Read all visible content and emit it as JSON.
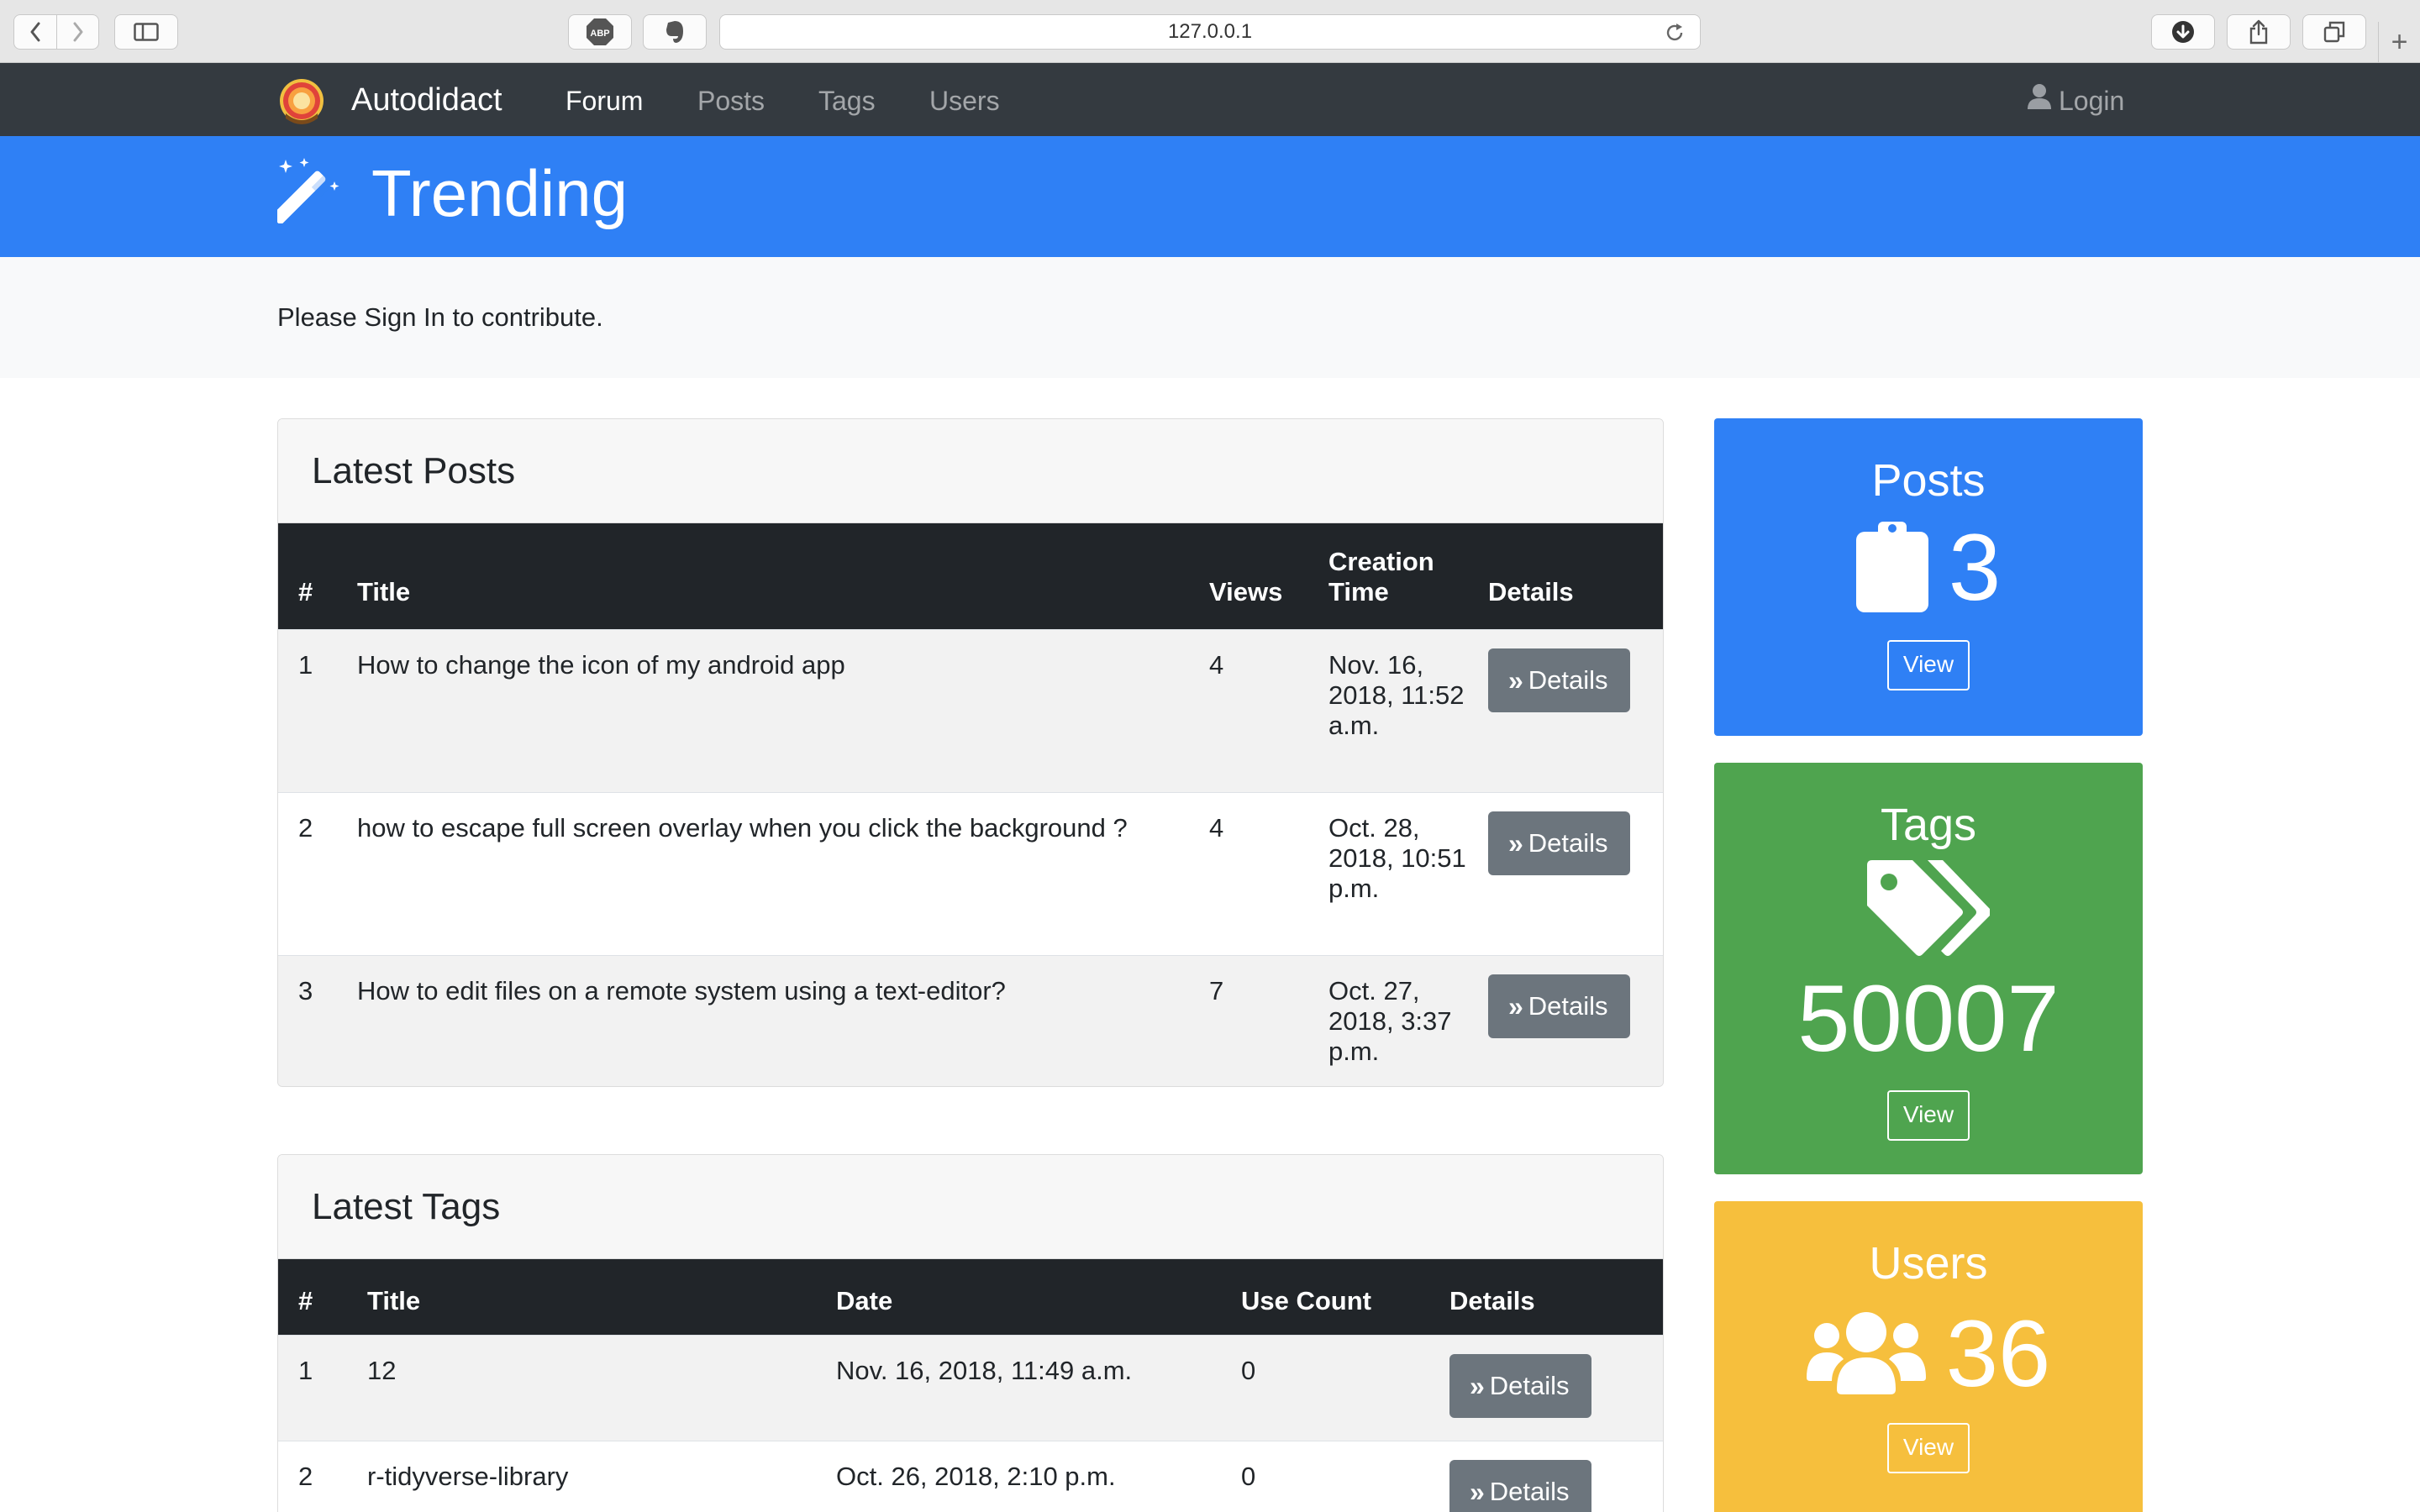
{
  "browser": {
    "url": "127.0.0.1",
    "icons": [
      "back-icon",
      "forward-icon",
      "sidebar-icon",
      "adblock-icon",
      "evernote-icon",
      "reload-icon",
      "download-icon",
      "share-icon",
      "tabs-icon",
      "new-tab-icon"
    ],
    "new_tab": "+"
  },
  "navbar": {
    "brand": "Autodidact",
    "links": [
      {
        "label": "Forum",
        "active": true
      },
      {
        "label": "Posts",
        "active": false
      },
      {
        "label": "Tags",
        "active": false
      },
      {
        "label": "Users",
        "active": false
      }
    ],
    "login": "Login"
  },
  "banner": {
    "title": "Trending",
    "color": "#2f80f5"
  },
  "notice": "Please Sign In to contribute.",
  "latest_posts": {
    "title": "Latest Posts",
    "columns": [
      "#",
      "Title",
      "Views",
      "Creation Time",
      "Details"
    ],
    "rows": [
      {
        "num": "1",
        "title": "How to change the icon of my android app",
        "views": "4",
        "time": "Nov. 16, 2018, 11:52 a.m.",
        "button": "Details"
      },
      {
        "num": "2",
        "title": "how to escape full screen overlay when you click the background ?",
        "views": "4",
        "time": "Oct. 28, 2018, 10:51 p.m.",
        "button": "Details"
      },
      {
        "num": "3",
        "title": "How to edit files on a remote system using a text-editor?",
        "views": "7",
        "time": "Oct. 27, 2018, 3:37 p.m.",
        "button": "Details"
      }
    ]
  },
  "latest_tags": {
    "title": "Latest Tags",
    "columns": [
      "#",
      "Title",
      "Date",
      "Use Count",
      "Details"
    ],
    "rows": [
      {
        "num": "1",
        "title": "12",
        "date": "Nov. 16, 2018, 11:49 a.m.",
        "count": "0",
        "button": "Details"
      },
      {
        "num": "2",
        "title": "r-tidyverse-library",
        "date": "Oct. 26, 2018, 2:10 p.m.",
        "count": "0",
        "button": "Details"
      }
    ]
  },
  "stats": [
    {
      "title": "Posts",
      "count": "3",
      "view": "View",
      "color": "#2f80f5",
      "icon": "clipboard-icon"
    },
    {
      "title": "Tags",
      "count": "50007",
      "view": "View",
      "color": "#4fa44f",
      "icon": "tags-icon"
    },
    {
      "title": "Users",
      "count": "36",
      "view": "View",
      "color": "#f6bf3d",
      "icon": "users-icon"
    }
  ]
}
